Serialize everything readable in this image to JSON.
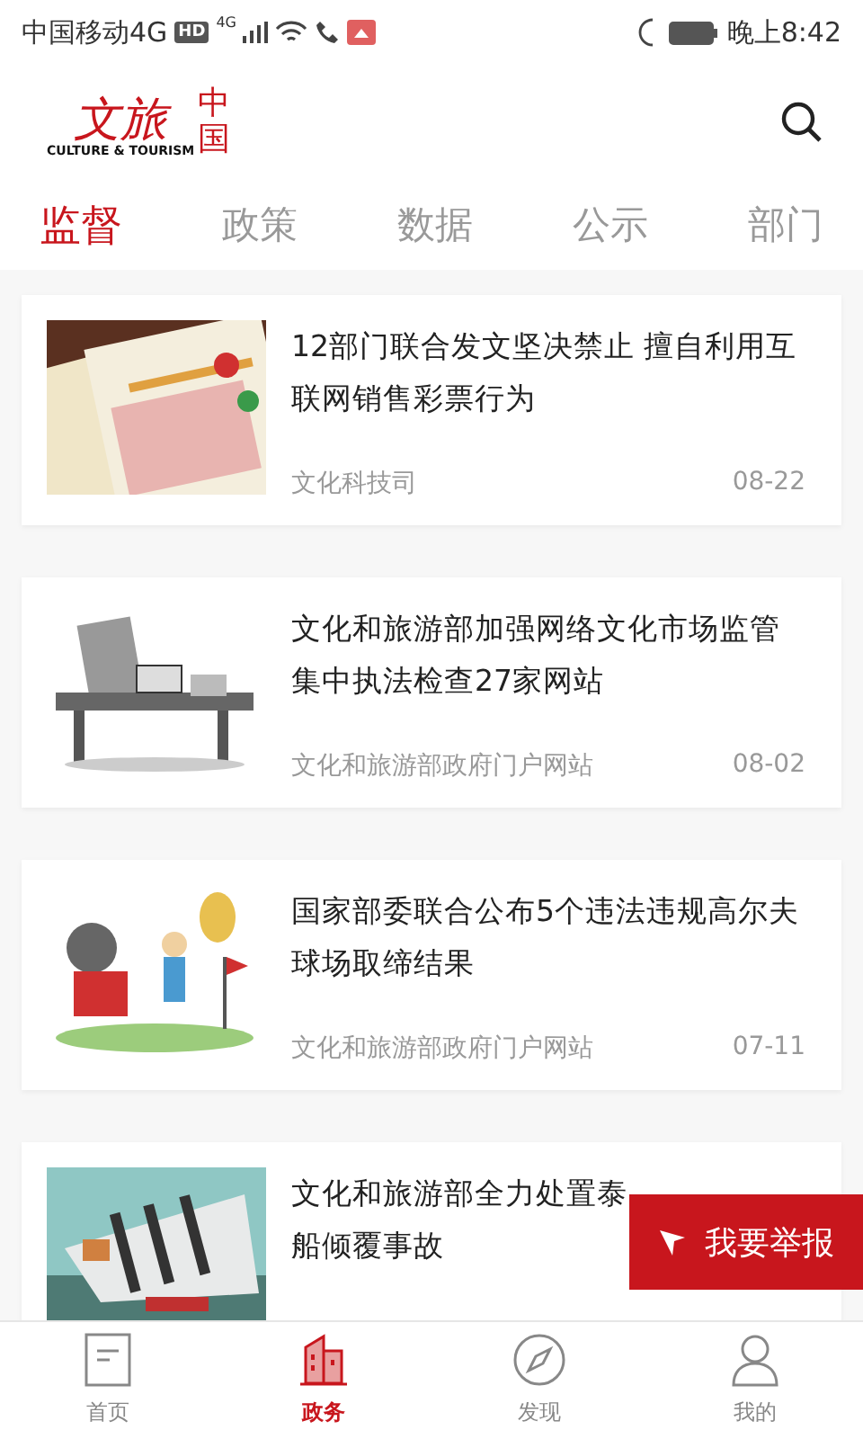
{
  "status_bar": {
    "carrier": "中国移动4G",
    "hd_badge": "HD",
    "network": "4G",
    "time": "晚上8:42"
  },
  "header": {
    "logo": {
      "chars_main": "文旅",
      "chars_side": "中国",
      "subtitle": "CULTURE & TOURISM"
    }
  },
  "tabs": [
    {
      "label": "监督",
      "selected": true
    },
    {
      "label": "政策",
      "selected": false
    },
    {
      "label": "数据",
      "selected": false
    },
    {
      "label": "公示",
      "selected": false
    },
    {
      "label": "部门",
      "selected": false
    }
  ],
  "articles": [
    {
      "title_lines": [
        "12部门联合发文坚决禁止 擅自利用互",
        "联网销售彩票行为"
      ],
      "source": "文化科技司",
      "date": "08-22"
    },
    {
      "title_lines": [
        "文化和旅游部加强网络文化市场监管",
        "集中执法检查27家网站"
      ],
      "source": "文化和旅游部政府门户网站",
      "date": "08-02"
    },
    {
      "title_lines": [
        "国家部委联合公布5个违法违规高尔夫",
        "球场取缔结果"
      ],
      "source": "文化和旅游部政府门户网站",
      "date": "07-11"
    },
    {
      "title_lines": [
        "文化和旅游部全力处置泰",
        "船倾覆事故"
      ]
    }
  ],
  "report_button": {
    "label": "我要举报"
  },
  "bottom_nav": [
    {
      "label": "首页",
      "selected": false
    },
    {
      "label": "政务",
      "selected": true
    },
    {
      "label": "发现",
      "selected": false
    },
    {
      "label": "我的",
      "selected": false
    }
  ]
}
